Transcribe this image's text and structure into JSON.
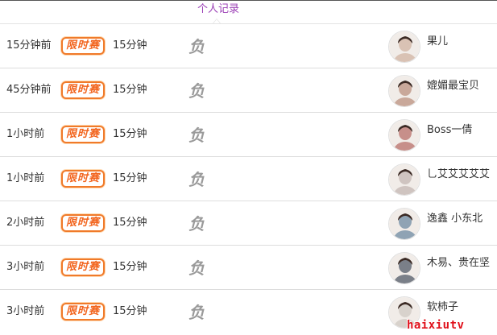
{
  "tabs": {
    "active": "个人记录"
  },
  "rows": [
    {
      "time": "15分钟前",
      "badge": "限时赛",
      "duration": "15分钟",
      "result": "负",
      "name": "果儿",
      "avatar_tone": "#d9c2b4"
    },
    {
      "time": "45分钟前",
      "badge": "限时赛",
      "duration": "15分钟",
      "result": "负",
      "name": "媲媚最宝贝",
      "avatar_tone": "#c9a89a"
    },
    {
      "time": "1小时前",
      "badge": "限时赛",
      "duration": "15分钟",
      "result": "负",
      "name": "Boss一倩",
      "avatar_tone": "#c78f8a"
    },
    {
      "time": "1小时前",
      "badge": "限时赛",
      "duration": "15分钟",
      "result": "负",
      "name": "乚艾艾艾艾艾",
      "avatar_tone": "#cfc4c0"
    },
    {
      "time": "2小时前",
      "badge": "限时赛",
      "duration": "15分钟",
      "result": "负",
      "name": "逸鑫 小东北",
      "avatar_tone": "#8fa3b4"
    },
    {
      "time": "3小时前",
      "badge": "限时赛",
      "duration": "15分钟",
      "result": "负",
      "name": "木易、贵在坚",
      "avatar_tone": "#7a7f88"
    },
    {
      "time": "3小时前",
      "badge": "限时赛",
      "duration": "15分钟",
      "result": "负",
      "name": "软柿子",
      "avatar_tone": "#d8d2cc"
    }
  ],
  "watermark": "haixiutv",
  "colors": {
    "accent": "#9b3fb6",
    "badge": "#f2641d",
    "result": "#9a9a9a",
    "watermark": "#e0101a"
  }
}
